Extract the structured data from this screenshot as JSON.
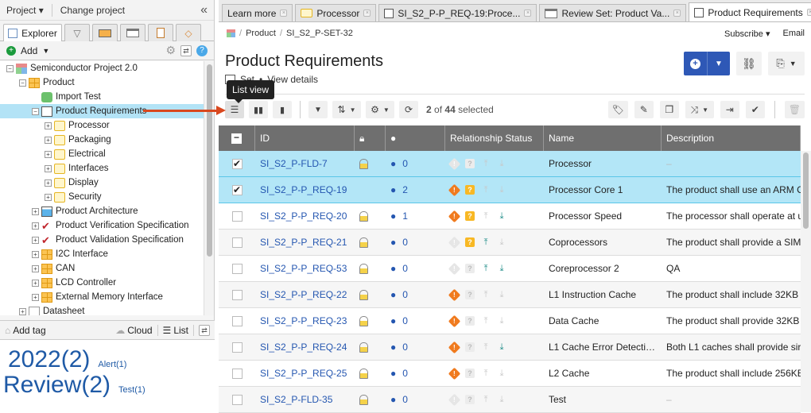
{
  "left_panel": {
    "project_menu": "Project",
    "change_project": "Change project",
    "tabs": [
      {
        "name": "explorer",
        "label": "Explorer",
        "active": true
      },
      {
        "name": "filter",
        "label": ""
      },
      {
        "name": "releases",
        "label": ""
      },
      {
        "name": "window",
        "label": ""
      },
      {
        "name": "clipboard",
        "label": ""
      },
      {
        "name": "tags",
        "label": ""
      }
    ],
    "add_label": "Add",
    "tree": [
      {
        "label": "Semiconductor Project 2.0",
        "level": 0,
        "icon": "project-icon",
        "toggle": "-"
      },
      {
        "label": "Product",
        "level": 1,
        "icon": "component-icon",
        "toggle": "-"
      },
      {
        "label": "Import Test",
        "level": 2,
        "icon": "puzzle-icon",
        "toggle": ""
      },
      {
        "label": "Product Requirements",
        "level": 2,
        "icon": "set-icon",
        "toggle": "-",
        "selected": true
      },
      {
        "label": "Processor",
        "level": 3,
        "icon": "folder-icon",
        "toggle": "+"
      },
      {
        "label": "Packaging",
        "level": 3,
        "icon": "folder-icon",
        "toggle": "+"
      },
      {
        "label": "Electrical",
        "level": 3,
        "icon": "folder-icon",
        "toggle": "+"
      },
      {
        "label": "Interfaces",
        "level": 3,
        "icon": "folder-icon",
        "toggle": "+"
      },
      {
        "label": "Display",
        "level": 3,
        "icon": "folder-icon",
        "toggle": "+"
      },
      {
        "label": "Security",
        "level": 3,
        "icon": "folder-icon",
        "toggle": "+"
      },
      {
        "label": "Product Architecture",
        "level": 2,
        "icon": "diagram-icon",
        "toggle": "+"
      },
      {
        "label": "Product Verification Specification",
        "level": 2,
        "icon": "checkmark-icon",
        "toggle": "+"
      },
      {
        "label": "Product Validation Specification",
        "level": 2,
        "icon": "checkmark-icon",
        "toggle": "+"
      },
      {
        "label": "I2C Interface",
        "level": 2,
        "icon": "component-icon",
        "toggle": "+"
      },
      {
        "label": "CAN",
        "level": 2,
        "icon": "component-icon",
        "toggle": "+"
      },
      {
        "label": "LCD Controller",
        "level": 2,
        "icon": "component-icon",
        "toggle": "+"
      },
      {
        "label": "External Memory Interface",
        "level": 2,
        "icon": "component-icon",
        "toggle": "+"
      },
      {
        "label": "Datasheet",
        "level": 1,
        "icon": "document-icon",
        "toggle": "+"
      }
    ],
    "tag_panel": {
      "add_tag": "Add tag",
      "cloud": "Cloud",
      "list": "List",
      "tags": [
        {
          "label": "2022(2)",
          "size": "big"
        },
        {
          "label": "Alert(1)",
          "size": "small"
        },
        {
          "label": "Review(2)",
          "size": "big"
        },
        {
          "label": "Test(1)",
          "size": "small"
        }
      ]
    }
  },
  "main": {
    "tabs": [
      {
        "label": "Learn more",
        "icon": ""
      },
      {
        "label": "Processor",
        "icon": "folder-icon"
      },
      {
        "label": "SI_S2_P-P_REQ-19:Proce...",
        "icon": "set-icon"
      },
      {
        "label": "Review Set: Product Va...",
        "icon": "window-icon"
      },
      {
        "label": "Product Requirements",
        "icon": "set-icon",
        "active": true
      }
    ],
    "breadcrumb": [
      "Product",
      "SI_S2_P-SET-32"
    ],
    "subscribe": "Subscribe",
    "email": "Email",
    "title": "Product Requirements",
    "subtitle_type": "Set",
    "view_details": "View details",
    "tooltip": "List view",
    "selection": {
      "selected": "2",
      "total": "44",
      "text_of": "of",
      "text_selected": "selected"
    },
    "columns": [
      "ID",
      "",
      "",
      "Relationship Status",
      "Name",
      "Description"
    ],
    "rows": [
      {
        "id": "SI_S2_P-FLD-7",
        "checked": true,
        "locked": true,
        "comments": "0",
        "suspect": "off",
        "question": "off",
        "up": "off",
        "down": "off",
        "name": "Processor",
        "description": "–"
      },
      {
        "id": "SI_S2_P-P_REQ-19",
        "checked": true,
        "locked": false,
        "comments": "2",
        "suspect": "on",
        "question": "on",
        "up": "off",
        "down": "off",
        "name": "Processor Core 1",
        "description": "The product shall use an ARM C"
      },
      {
        "id": "SI_S2_P-P_REQ-20",
        "checked": false,
        "locked": true,
        "comments": "1",
        "suspect": "on",
        "question": "on",
        "up": "off",
        "down": "on",
        "name": "Processor Speed",
        "description": "The processor shall operate at u"
      },
      {
        "id": "SI_S2_P-P_REQ-21",
        "checked": false,
        "locked": true,
        "comments": "0",
        "suspect": "off",
        "question": "on",
        "up": "on",
        "down": "off",
        "name": "Coprocessors",
        "description": "The product shall provide a SIM"
      },
      {
        "id": "SI_S2_P-P_REQ-53",
        "checked": false,
        "locked": true,
        "comments": "0",
        "suspect": "off",
        "question": "off",
        "up": "on",
        "down": "on",
        "name": "Coreprocessor 2",
        "description": "QA"
      },
      {
        "id": "SI_S2_P-P_REQ-22",
        "checked": false,
        "locked": true,
        "comments": "0",
        "suspect": "on",
        "question": "off",
        "up": "off",
        "down": "off",
        "name": "L1 Instruction Cache",
        "description": "The product shall include 32KB"
      },
      {
        "id": "SI_S2_P-P_REQ-23",
        "checked": false,
        "locked": true,
        "comments": "0",
        "suspect": "on",
        "question": "off",
        "up": "off",
        "down": "off",
        "name": "Data Cache",
        "description": "The product shall provide 32KB"
      },
      {
        "id": "SI_S2_P-P_REQ-24",
        "checked": false,
        "locked": true,
        "comments": "0",
        "suspect": "on",
        "question": "off",
        "up": "off",
        "down": "on",
        "name": "L1 Cache Error Detecti…",
        "description": "Both L1 caches shall provide sir"
      },
      {
        "id": "SI_S2_P-P_REQ-25",
        "checked": false,
        "locked": true,
        "comments": "0",
        "suspect": "on",
        "question": "off",
        "up": "off",
        "down": "off",
        "name": "L2 Cache",
        "description": "The product shall include 256KE"
      },
      {
        "id": "SI_S2_P-FLD-35",
        "checked": false,
        "locked": true,
        "comments": "0",
        "suspect": "off",
        "question": "off",
        "up": "off",
        "down": "off",
        "name": "Test",
        "description": "–"
      }
    ]
  },
  "colors": {
    "accent_blue": "#2e58b6",
    "link_blue": "#2456b0",
    "selected_row": "#b3e6f7",
    "suspect_orange": "#f07b1f",
    "question_yellow": "#f8b824",
    "trace_teal": "#1a8a86",
    "arrow_red": "#d9481f"
  }
}
